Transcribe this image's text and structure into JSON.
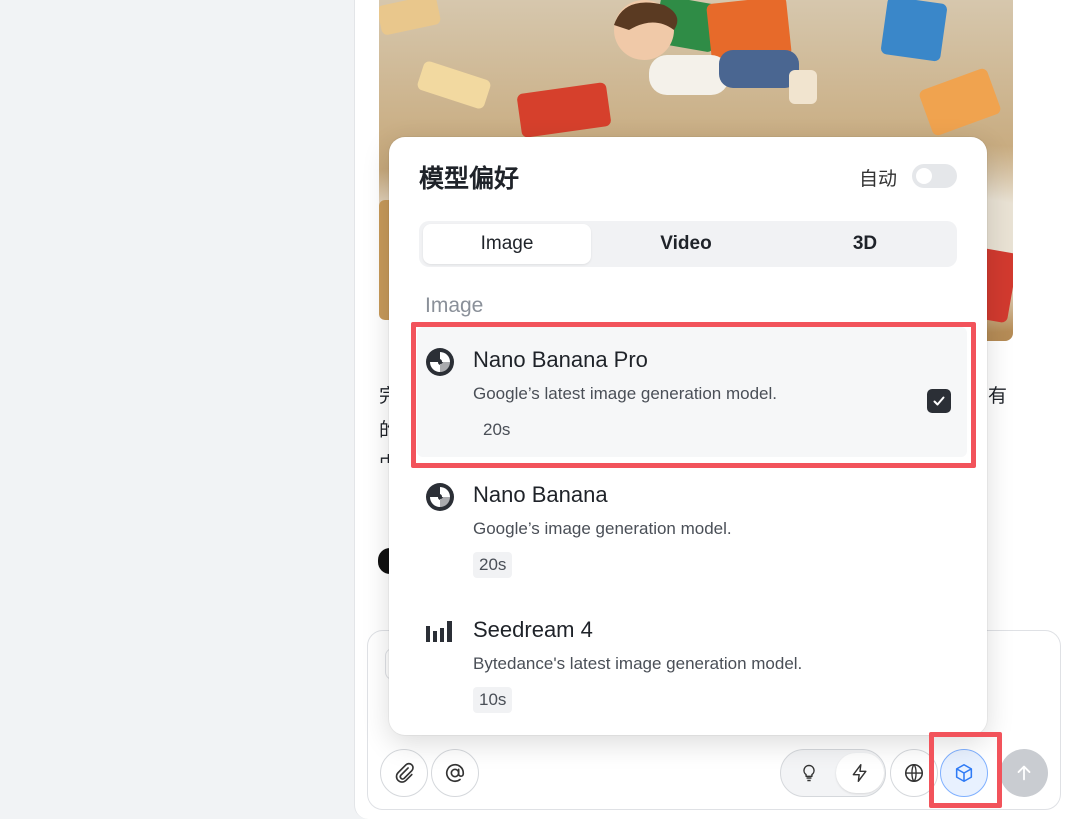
{
  "background_text": {
    "left_char_1": "完",
    "left_char_2": "的",
    "left_char_3": "中",
    "right_char_1": "有"
  },
  "popover": {
    "title": "模型偏好",
    "auto_label": "自动",
    "auto_enabled": false,
    "tabs": [
      {
        "label": "Image",
        "active": true
      },
      {
        "label": "Video",
        "active": false
      },
      {
        "label": "3D",
        "active": false
      }
    ],
    "section_label": "Image",
    "models": [
      {
        "name": "Nano Banana Pro",
        "description": "Google’s latest image generation model.",
        "time": "20s",
        "selected": true,
        "icon": "gemini-swirl-icon"
      },
      {
        "name": "Nano Banana",
        "description": "Google’s image generation model.",
        "time": "20s",
        "selected": false,
        "icon": "gemini-swirl-icon"
      },
      {
        "name": "Seedream 4",
        "description": "Bytedance's latest image generation model.",
        "time": "10s",
        "selected": false,
        "icon": "bars-logo-icon"
      }
    ]
  },
  "toolbar": {
    "attach_icon": "paperclip-icon",
    "mention_icon": "at-icon",
    "mode_icons": [
      "lightbulb-icon",
      "lightning-icon"
    ],
    "web_icon": "globe-icon",
    "model_icon": "cube-icon",
    "send_icon": "arrow-up-icon"
  },
  "colors": {
    "accent_blue": "#2f7bf6",
    "highlight_red": "#f2535b",
    "checkbox_dark": "#2b2f36"
  }
}
